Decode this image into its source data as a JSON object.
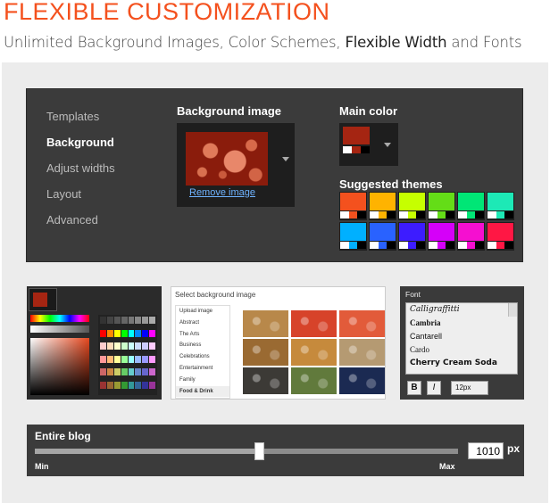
{
  "header": {
    "title": "FLEXIBLE CUSTOMIZATION",
    "subtitle_part1": "Unlimited Background Images, Color Schemes, ",
    "subtitle_bold": "Flexible Width",
    "subtitle_part2": " and Fonts"
  },
  "designer": {
    "nav": [
      {
        "label": "Templates",
        "active": false
      },
      {
        "label": "Background",
        "active": true
      },
      {
        "label": "Adjust widths",
        "active": false
      },
      {
        "label": "Layout",
        "active": false
      },
      {
        "label": "Advanced",
        "active": false
      }
    ],
    "background_title": "Background image",
    "remove_label": "Remove image",
    "main_color_title": "Main color",
    "main_color": {
      "top": "#a52512",
      "row": [
        "#ffffff",
        "#a52512",
        "#000000"
      ]
    },
    "themes_title": "Suggested themes",
    "themes": [
      {
        "top": "#f4511e",
        "row": [
          "#ffffff",
          "#f4511e",
          "#000000"
        ]
      },
      {
        "top": "#ffb300",
        "row": [
          "#ffffff",
          "#ffb300",
          "#000000"
        ]
      },
      {
        "top": "#c6ff00",
        "row": [
          "#ffffff",
          "#c6ff00",
          "#000000"
        ]
      },
      {
        "top": "#64dd17",
        "row": [
          "#ffffff",
          "#64dd17",
          "#000000"
        ]
      },
      {
        "top": "#00e676",
        "row": [
          "#ffffff",
          "#00e676",
          "#000000"
        ]
      },
      {
        "top": "#1de9b6",
        "row": [
          "#ffffff",
          "#1de9b6",
          "#000000"
        ]
      },
      {
        "top": "#00b0ff",
        "row": [
          "#ffffff",
          "#00b0ff",
          "#000000"
        ]
      },
      {
        "top": "#2962ff",
        "row": [
          "#ffffff",
          "#2962ff",
          "#000000"
        ]
      },
      {
        "top": "#3d1cff",
        "row": [
          "#ffffff",
          "#3d1cff",
          "#000000"
        ]
      },
      {
        "top": "#d500f9",
        "row": [
          "#ffffff",
          "#d500f9",
          "#000000"
        ]
      },
      {
        "top": "#f50fd0",
        "row": [
          "#ffffff",
          "#f50fd0",
          "#000000"
        ]
      },
      {
        "top": "#ff1744",
        "row": [
          "#ffffff",
          "#ff1744",
          "#000000"
        ]
      }
    ]
  },
  "bg_selector": {
    "title": "Select background image",
    "categories": [
      {
        "label": "Upload image",
        "current": false
      },
      {
        "label": "Abstract",
        "current": false
      },
      {
        "label": "The Arts",
        "current": false
      },
      {
        "label": "Business",
        "current": false
      },
      {
        "label": "Celebrations",
        "current": false
      },
      {
        "label": "Entertainment",
        "current": false
      },
      {
        "label": "Family",
        "current": false
      },
      {
        "label": "Food & Drink",
        "current": true
      }
    ],
    "thumb_colors": [
      "#b8884a",
      "#d7432a",
      "#e25b3a",
      "#9a6a32",
      "#c68a3c",
      "#b59a72",
      "#3c3a36",
      "#617a3c",
      "#1b2a52"
    ]
  },
  "font_panel": {
    "title": "Font",
    "fonts": [
      "Calligraffitti",
      "Cambria",
      "Cantarell",
      "Cardo",
      "Cherry Cream Soda"
    ],
    "bold_label": "B",
    "italic_label": "I",
    "size": "12px"
  },
  "width_slider": {
    "title": "Entire blog",
    "min_label": "Min",
    "max_label": "Max",
    "value": "1010",
    "unit": "px",
    "position": 0.53
  }
}
